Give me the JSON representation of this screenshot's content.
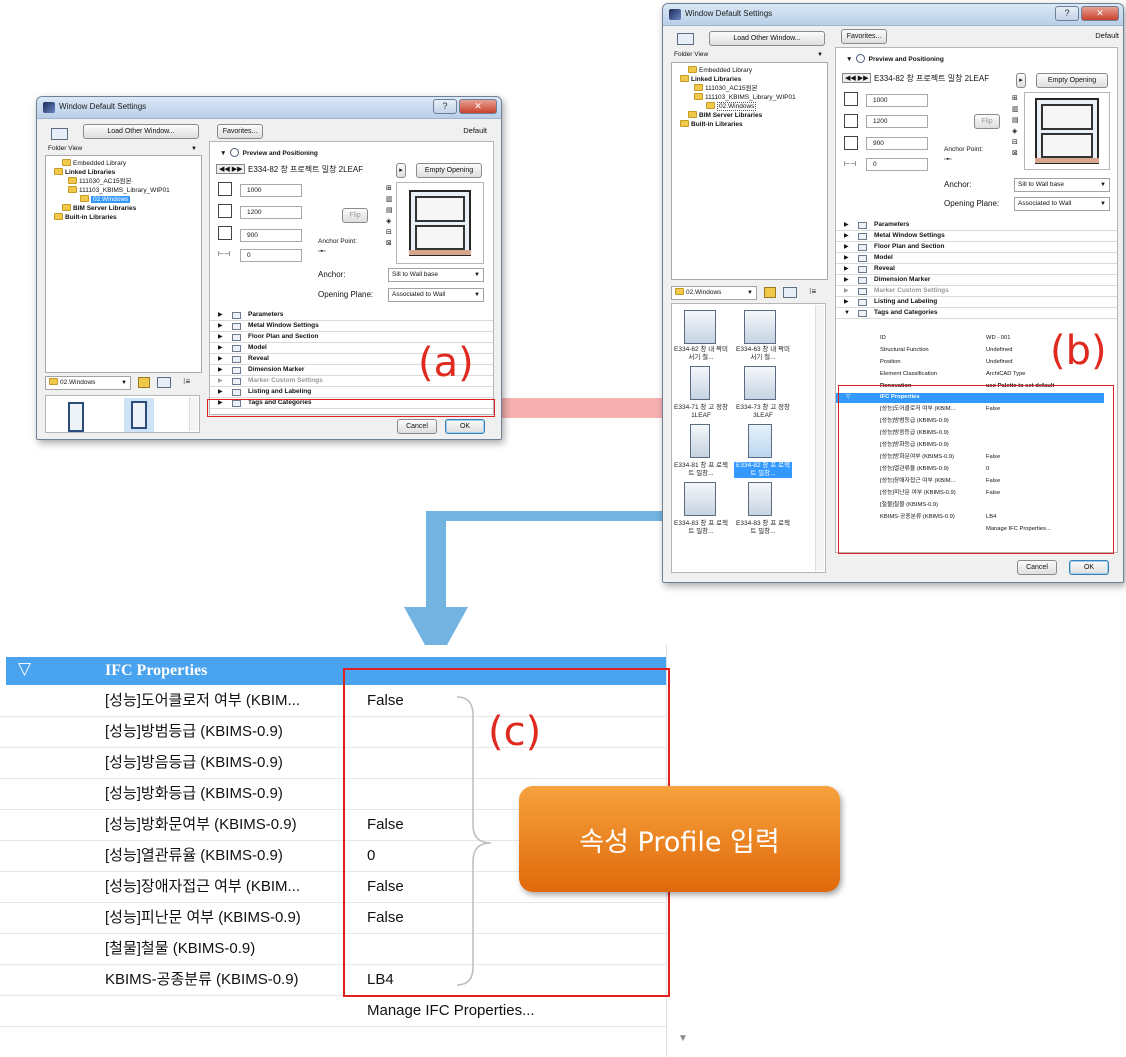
{
  "dialog_a": {
    "title": "Window Default Settings",
    "load_other": "Load Other Window...",
    "favorites": "Favorites...",
    "default": "Default",
    "folder_view": "Folder View",
    "tree": [
      "Embedded Library",
      "Linked Libraries",
      "111030_AC15원본",
      "111103_KBIMS_Library_WIP01",
      "02.Windows",
      "BIM Server Libraries",
      "Built-in Libraries"
    ],
    "section_preview": "Preview and Positioning",
    "object_name": "E334-82 창 프로젝트 밀창 2LEAF",
    "empty_opening": "Empty Opening",
    "width": "1000",
    "height": "1200",
    "sill": "900",
    "offset": "0",
    "flip": "Flip",
    "anchor_point": "Anchor Point:",
    "anchor_label": "Anchor:",
    "anchor_value": "Sill to Wall base",
    "opening_plane_label": "Opening Plane:",
    "opening_plane_value": "Associated to Wall",
    "sections": [
      "Parameters",
      "Metal Window Settings",
      "Floor Plan and Section",
      "Model",
      "Reveal",
      "Dimension Marker",
      "Marker Custom Settings",
      "Listing and Labeling",
      "Tags and Categories"
    ],
    "folder_combo": "02.Windows",
    "cancel": "Cancel",
    "ok": "OK",
    "callout": "(a)"
  },
  "dialog_b": {
    "title": "Window Default Settings",
    "load_other": "Load Other Window...",
    "favorites": "Favorites...",
    "default": "Default",
    "folder_view": "Folder View",
    "tree": [
      "Embedded Library",
      "Linked Libraries",
      "111030_AC15원본",
      "111103_KBIMS_Library_WIP01",
      "02.Windows",
      "BIM Server Libraries",
      "Built-in Libraries"
    ],
    "section_preview": "Preview and Positioning",
    "object_name": "E334-82 창 프로젝트 밀창 2LEAF",
    "empty_opening": "Empty Opening",
    "width": "1000",
    "height": "1200",
    "sill": "900",
    "offset": "0",
    "flip": "Flip",
    "anchor_point": "Anchor Point:",
    "anchor_label": "Anchor:",
    "anchor_value": "Sill to Wall base",
    "opening_plane_label": "Opening Plane:",
    "opening_plane_value": "Associated to Wall",
    "sections": [
      "Parameters",
      "Metal Window Settings",
      "Floor Plan and Section",
      "Model",
      "Reveal",
      "Dimension Marker",
      "Marker Custom Settings",
      "Listing and Labeling",
      "Tags and Categories"
    ],
    "folder_combo": "02.Windows",
    "tiles": [
      "E334-62 창 내 짝미서기 철...",
      "E334-63 창 내 짝미서기 철...",
      "E334-71 창 고 정창 1LEAF",
      "E334-73 창 고 정창 3LEAF",
      "E334-81 창 프 로젝트 밀창...",
      "E334-82 창 프 로젝트 밀창...",
      "E334-83 창 프 로젝트 밀창...",
      "E334-83 창 프 로젝트 밀창..."
    ],
    "tags_rows": [
      {
        "k": "ID",
        "v": "WD - 001"
      },
      {
        "k": "Structural Function",
        "v": "Undefined"
      },
      {
        "k": "Position",
        "v": "Undefined"
      },
      {
        "k": "Element Classification",
        "v": "ArchiCAD Type"
      },
      {
        "k": "Renovation",
        "v": "use Palette to set default"
      }
    ],
    "ifc_header": "IFC Properties",
    "ifc_rows": [
      {
        "k": "[성능]도어클로저 여부 (KBIM...",
        "v": "False"
      },
      {
        "k": "[성능]방범등급 (KBIMS-0.9)",
        "v": ""
      },
      {
        "k": "[성능]방음등급 (KBIMS-0.9)",
        "v": ""
      },
      {
        "k": "[성능]방화등급 (KBIMS-0.9)",
        "v": ""
      },
      {
        "k": "[성능]방화문여부 (KBIMS-0.9)",
        "v": "False"
      },
      {
        "k": "[성능]열관류율 (KBIMS-0.9)",
        "v": "0"
      },
      {
        "k": "[성능]장애자접근 여부 (KBIM...",
        "v": "False"
      },
      {
        "k": "[성능]피난문 여부 (KBIMS-0.9)",
        "v": "False"
      },
      {
        "k": "[철물]철물 (KBIMS-0.9)",
        "v": ""
      },
      {
        "k": "KBIMS-공종분류 (KBIMS-0.9)",
        "v": "LB4"
      }
    ],
    "manage": "Manage IFC Properties...",
    "cancel": "Cancel",
    "ok": "OK",
    "callout": "(b)"
  },
  "zoom_c": {
    "header": "IFC Properties",
    "rows": [
      {
        "k": "[성능]도어클로저 여부 (KBIM...",
        "v": "False"
      },
      {
        "k": "[성능]방범등급 (KBIMS-0.9)",
        "v": ""
      },
      {
        "k": "[성능]방음등급 (KBIMS-0.9)",
        "v": ""
      },
      {
        "k": "[성능]방화등급 (KBIMS-0.9)",
        "v": ""
      },
      {
        "k": "[성능]방화문여부 (KBIMS-0.9)",
        "v": "False"
      },
      {
        "k": "[성능]열관류율 (KBIMS-0.9)",
        "v": "0"
      },
      {
        "k": "[성능]장애자접근 여부 (KBIM...",
        "v": "False"
      },
      {
        "k": "[성능]피난문 여부 (KBIMS-0.9)",
        "v": "False"
      },
      {
        "k": "[철물]철물 (KBIMS-0.9)",
        "v": ""
      },
      {
        "k": "KBIMS-공종분류 (KBIMS-0.9)",
        "v": "LB4"
      }
    ],
    "manage": "Manage IFC Properties...",
    "callout": "(c)",
    "badge": "속성 Profile 입력"
  },
  "colors": {
    "accent_red": "#e02020",
    "arrow_red": "#f4a3a3",
    "arrow_blue": "#5aa6dd",
    "select_blue": "#3399ff",
    "badge_orange": "#ee7a12"
  }
}
